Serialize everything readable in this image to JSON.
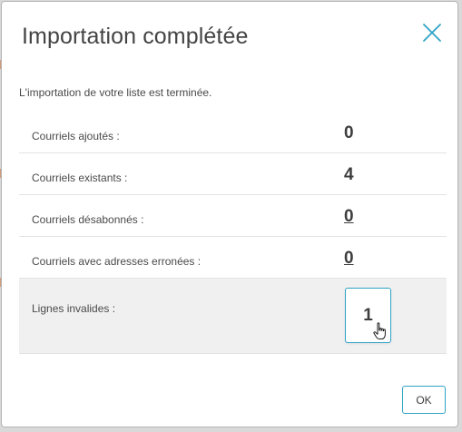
{
  "dialog": {
    "title": "Importation complétée",
    "intro": "L'importation de votre liste est terminée.",
    "close_icon": "close-icon",
    "ok_label": "OK"
  },
  "results": [
    {
      "label": "Courriels ajoutés :",
      "value": "0",
      "style": "plain"
    },
    {
      "label": "Courriels existants :",
      "value": "4",
      "style": "plain"
    },
    {
      "label": "Courriels désabonnés :",
      "value": "0",
      "style": "link"
    },
    {
      "label": "Courriels avec adresses erronées :",
      "value": "0",
      "style": "link"
    },
    {
      "label": "Lignes invalides :",
      "value": "1",
      "style": "button"
    }
  ],
  "colors": {
    "accent": "#2fa4c5",
    "text": "#4a4a4a",
    "highlight_row": "#f0f0f0"
  }
}
